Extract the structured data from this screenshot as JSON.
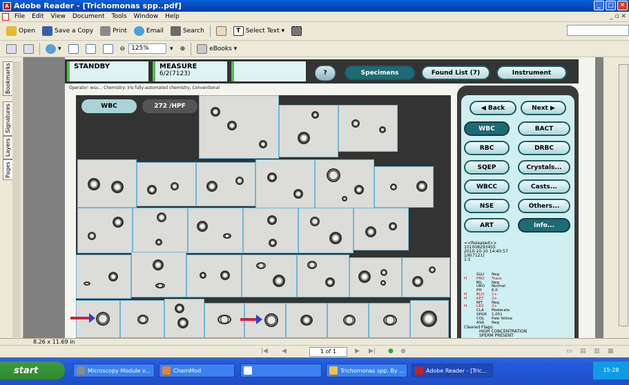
{
  "window": {
    "title": "Adobe Reader - [Trichomonas spp..pdf]"
  },
  "menu": [
    "File",
    "Edit",
    "View",
    "Document",
    "Tools",
    "Window",
    "Help"
  ],
  "toolbar": {
    "open": "Open",
    "save_copy": "Save a Copy",
    "print": "Print",
    "email": "Email",
    "search": "Search",
    "select_text": "Select Text",
    "zoom": "125%",
    "ebooks": "eBooks"
  },
  "nav_tabs": [
    "Bookmarks",
    "Signatures",
    "Layers",
    "Pages"
  ],
  "app": {
    "status": "STANDBY",
    "measure_label": "MEASURE",
    "measure_value": "6/2(7123)",
    "help": "?",
    "tabs": [
      "Specimens",
      "Found List (7)",
      "Instrument"
    ],
    "operator": "Operator: wsu...  Chemistry: Iris fully-automated chemistry, Conventional",
    "category": "WBC",
    "count": "272 /HPF",
    "nav": {
      "back": "Back",
      "next": "Next"
    },
    "buttons": [
      [
        "WBC",
        "BACT"
      ],
      [
        "RBC",
        "DRBC"
      ],
      [
        "SQEP",
        "Crystals..."
      ],
      [
        "WBCC",
        "Casts..."
      ],
      [
        "NSE",
        "Others..."
      ],
      [
        "ART",
        "Info..."
      ]
    ],
    "info_lines": [
      "<<Released>>",
      "1010082934S5",
      "2010-10-10 14:40:57",
      "1/6(7121)",
      "1:1"
    ],
    "results": [
      {
        "flag": "",
        "analyte": "GLU",
        "value": "Neg"
      },
      {
        "flag": "H",
        "analyte": "PRO",
        "value": "Trace"
      },
      {
        "flag": "",
        "analyte": "BIL",
        "value": "Neg"
      },
      {
        "flag": "",
        "analyte": "URO",
        "value": "Normal"
      },
      {
        "flag": "",
        "analyte": "PH",
        "value": "6.0"
      },
      {
        "flag": "H",
        "analyte": "BLD",
        "value": "1+"
      },
      {
        "flag": "H",
        "analyte": "KET",
        "value": "2+"
      },
      {
        "flag": "",
        "analyte": "NIT",
        "value": "Neg"
      },
      {
        "flag": "H",
        "analyte": "LEU",
        "value": "2+"
      },
      {
        "flag": "",
        "analyte": "CLA",
        "value": "Moderate"
      },
      {
        "flag": "",
        "analyte": "SPGR",
        "value": "1.051"
      },
      {
        "flag": "",
        "analyte": "COL",
        "value": "Pale Yellow"
      },
      {
        "flag": "",
        "analyte": "ASA",
        "value": "Neg"
      }
    ],
    "cleared_title": "Cleared Flags:",
    "cleared": [
      "HIGH CONCENTRATION",
      "SPERM PRESENT"
    ]
  },
  "document": {
    "page_size": "8.26 x 11.69 in",
    "page": "1 of 1"
  },
  "taskbar": {
    "start": "start",
    "tasks": [
      "Microscopy Module v...",
      "ChemMod",
      "",
      "Trichomonas spp. By ...",
      "Adobe Reader - [Tric..."
    ],
    "clock": "15:28"
  },
  "colors": {
    "active_teal": "#1f6b73",
    "panel_bg": "#cfeff1",
    "ok_green": "#4cc24c",
    "abnormal": "#cc0000"
  }
}
